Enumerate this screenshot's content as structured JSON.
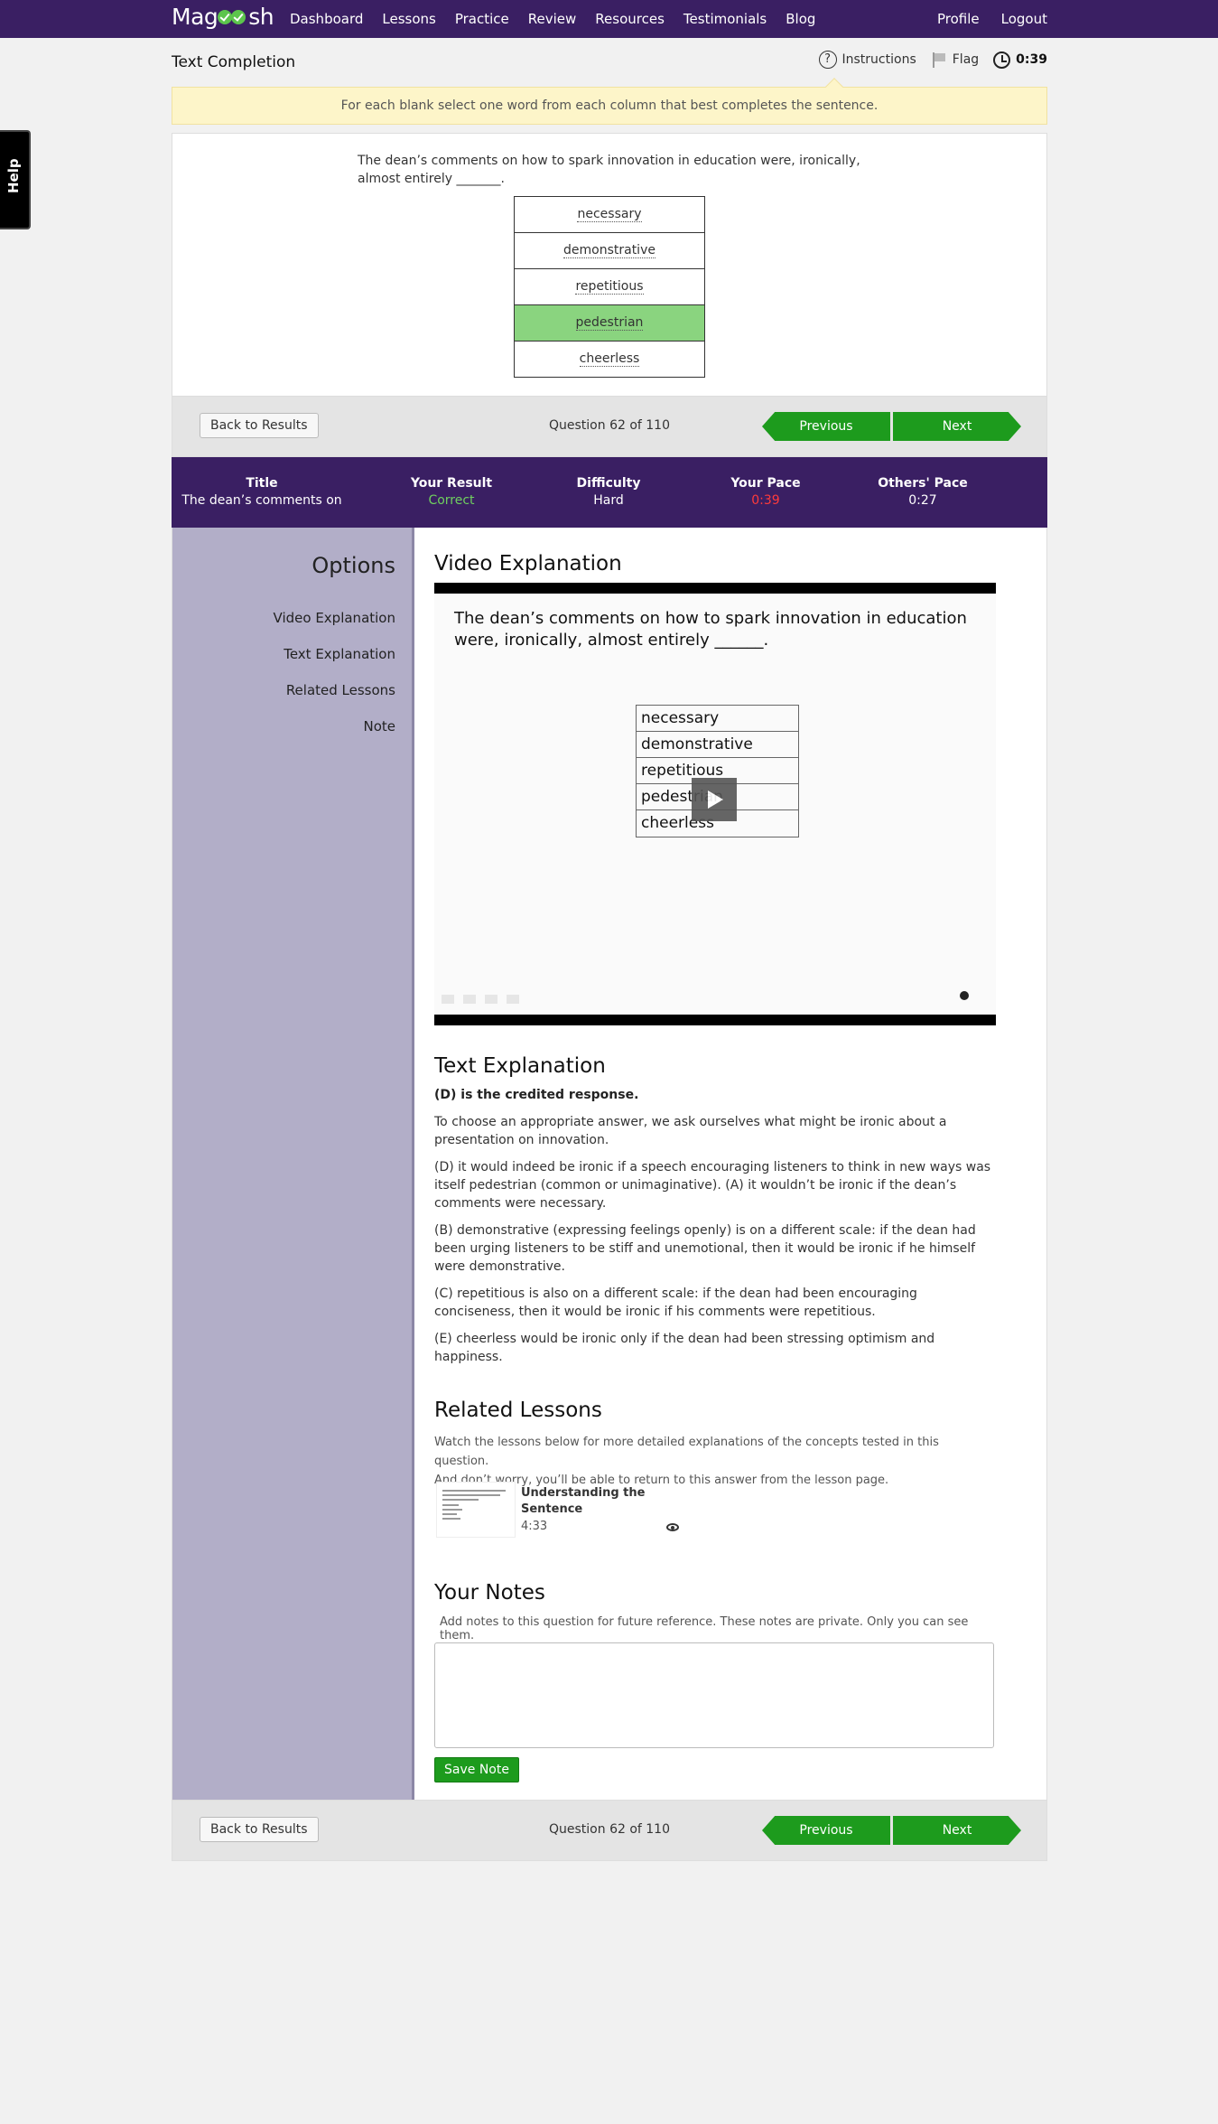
{
  "nav": {
    "logo": "Magoosh",
    "links": [
      "Dashboard",
      "Lessons",
      "Practice",
      "Review",
      "Resources",
      "Testimonials",
      "Blog"
    ],
    "right": [
      "Profile",
      "Logout"
    ]
  },
  "header": {
    "title": "Text Completion",
    "instructions": "Instructions",
    "flag": "Flag",
    "timer": "0:39"
  },
  "instruction_text": "For each blank select one word from each column that best completes the sentence.",
  "help_label": "Help",
  "question": {
    "text": "The dean’s comments on how to spark innovation in education were, ironically, almost entirely _______.",
    "choices": [
      "necessary",
      "demonstrative",
      "repetitious",
      "pedestrian",
      "cheerless"
    ],
    "selected": "pedestrian"
  },
  "navigation": {
    "back": "Back to Results",
    "count": "Question 62 of 110",
    "previous": "Previous",
    "next": "Next"
  },
  "stats": {
    "title_label": "Title",
    "title_value": "The dean’s comments on",
    "result_label": "Your Result",
    "result_value": "Correct",
    "difficulty_label": "Difficulty",
    "difficulty_value": "Hard",
    "pace_label": "Your Pace",
    "pace_value": "0:39",
    "others_label": "Others' Pace",
    "others_value": "0:27"
  },
  "options": {
    "title": "Options",
    "items": [
      "Video Explanation",
      "Text Explanation",
      "Related Lessons",
      "Note"
    ]
  },
  "video": {
    "heading": "Video Explanation",
    "question": "The dean’s comments on how to spark innovation in education were, ironically, almost entirely ______.",
    "choices": [
      "necessary",
      "demonstrative",
      "repetitious",
      "pedestrian",
      "cheerless"
    ]
  },
  "text_explanation": {
    "heading": "Text Explanation",
    "credited": "(D) is the credited response.",
    "paragraphs": [
      "To choose an appropriate answer, we ask ourselves what might be ironic about a presentation on innovation.",
      "(D) it would indeed be ironic if a speech encouraging listeners to think in new ways was itself pedestrian (common or unimaginative). (A) it wouldn’t be ironic if the dean’s comments were necessary.",
      "(B) demonstrative (expressing feelings openly) is on a different scale: if the dean had been urging listeners to be stiff and unemotional, then it would be ironic if he himself were demonstrative.",
      "(C) repetitious is also on a different scale: if the dean had been encouraging conciseness, then it would be ironic if his comments were repetitious.",
      "(E) cheerless would be ironic only if the dean had been stressing optimism and happiness."
    ]
  },
  "related": {
    "heading": "Related Lessons",
    "intro_1": "Watch the lessons below for more detailed explanations of the concepts tested in this question.",
    "intro_2": "And don’t worry, you’ll be able to return to this answer from the lesson page.",
    "lesson_title": "Understanding the Sentence",
    "lesson_duration": "4:33"
  },
  "notes": {
    "heading": "Your Notes",
    "intro": "Add notes to this question for future reference. These notes are private. Only you can see them.",
    "value": "",
    "save": "Save Note"
  },
  "colors": {
    "brand_purple": "#3a1f63",
    "accent_green": "#1d9b1d",
    "selected_green": "#8ad47f",
    "sidebar": "#b2aec8",
    "instruction_bg": "#fdf5c9"
  }
}
